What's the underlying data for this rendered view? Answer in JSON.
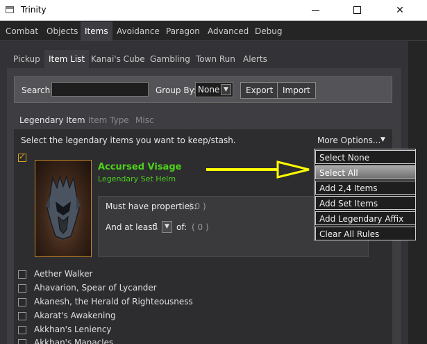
{
  "window": {
    "title": "Trinity"
  },
  "main_tabs": [
    {
      "label": "Combat"
    },
    {
      "label": "Objects"
    },
    {
      "label": "Items"
    },
    {
      "label": "Avoidance"
    },
    {
      "label": "Paragon"
    },
    {
      "label": "Advanced"
    },
    {
      "label": "Debug"
    }
  ],
  "sub_tabs": [
    {
      "label": "Pickup"
    },
    {
      "label": "Item List"
    },
    {
      "label": "Kanai's Cube"
    },
    {
      "label": "Gambling"
    },
    {
      "label": "Town Run"
    },
    {
      "label": "Alerts"
    }
  ],
  "search": {
    "label": "Search:",
    "value": "",
    "placeholder": ""
  },
  "group_by": {
    "label": "Group By:",
    "selected": "None"
  },
  "buttons": {
    "export": "Export",
    "import": "Import"
  },
  "inner_tabs": [
    {
      "label": "Legendary Item"
    },
    {
      "label": "Item Type"
    },
    {
      "label": "Misc"
    }
  ],
  "instruction": "Select the legendary items you want to keep/stash.",
  "more_options": {
    "label": "More Options..."
  },
  "dropdown_menu": [
    {
      "label": "Select None"
    },
    {
      "label": "Select All"
    },
    {
      "label": "Add 2,4 Items"
    },
    {
      "label": "Add Set Items"
    },
    {
      "label": "Add Legendary Affix Items"
    },
    {
      "label": "Clear All Rules"
    }
  ],
  "selected_item": {
    "name": "Accursed Visage",
    "type": "Legendary Set Helm",
    "must_have_label": "Must have properties:",
    "must_have_count": "( 0 )",
    "at_least_label": "And at least",
    "at_least_value": "1",
    "of_label": "of:",
    "of_count": "( 0 )"
  },
  "item_list": [
    {
      "label": "Aether Walker"
    },
    {
      "label": "Ahavarion, Spear of Lycander"
    },
    {
      "label": "Akanesh, the Herald of Righteousness"
    },
    {
      "label": "Akarat's Awakening"
    },
    {
      "label": "Akkhan's Leniency"
    },
    {
      "label": "Akkhan's Manacles"
    }
  ],
  "colors": {
    "accent_legendary": "#4ed11a",
    "checkbox_checked": "#e0b02a",
    "annotation_arrow": "#ffff00"
  }
}
